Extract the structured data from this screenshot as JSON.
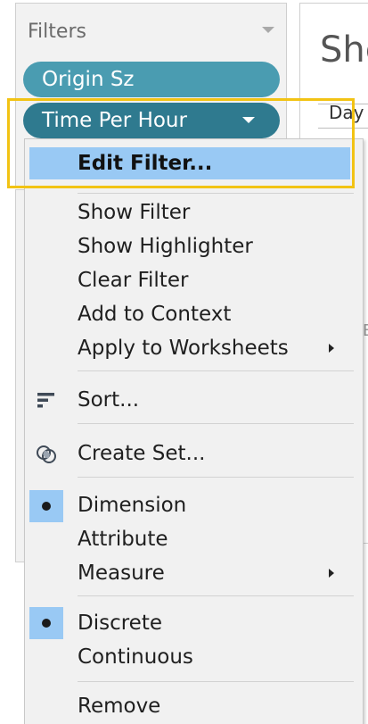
{
  "filters_panel": {
    "title": "Filters",
    "pills": [
      {
        "label": "Origin Sz"
      },
      {
        "label": "Time Per Hour"
      }
    ]
  },
  "sheet": {
    "title": "She",
    "column_header": "Day",
    "partial_text": "E"
  },
  "context_menu": {
    "edit_filter": "Edit Filter...",
    "show_filter": "Show Filter",
    "show_highlighter": "Show Highlighter",
    "clear_filter": "Clear Filter",
    "add_to_context": "Add to Context",
    "apply_to_worksheets": "Apply to Worksheets",
    "sort": "Sort...",
    "create_set": "Create Set...",
    "dimension": "Dimension",
    "attribute": "Attribute",
    "measure": "Measure",
    "discrete": "Discrete",
    "continuous": "Continuous",
    "remove": "Remove",
    "icons": {
      "sort": "sort-icon",
      "create_set": "set-icon"
    },
    "selected": {
      "role": "Dimension",
      "type": "Discrete"
    }
  },
  "colors": {
    "pill_origin": "#4a9cb1",
    "pill_time": "#2f7a8f",
    "menu_highlight": "#99c9f4",
    "annotation": "#f2c314"
  }
}
